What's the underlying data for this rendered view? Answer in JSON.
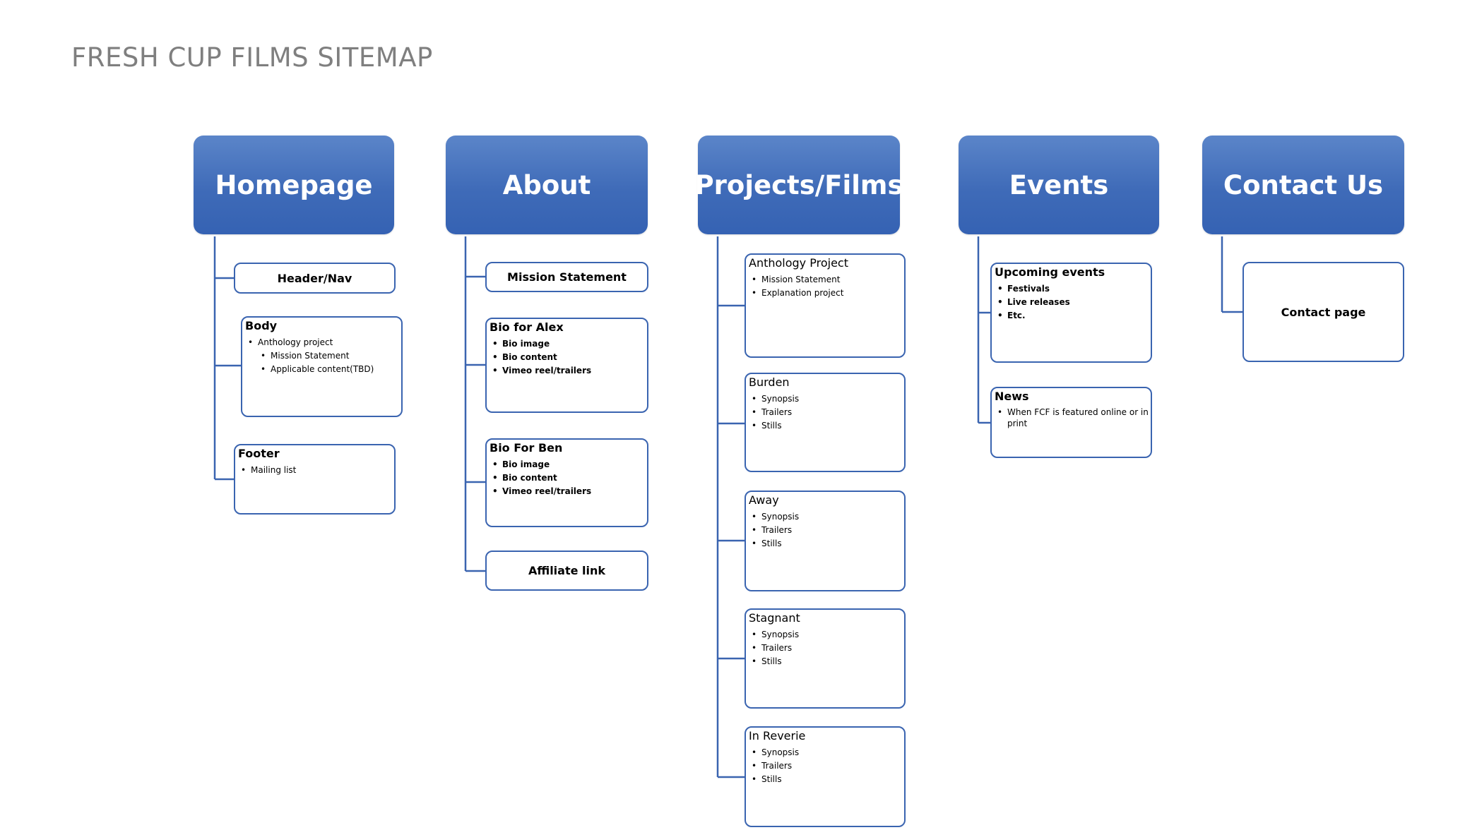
{
  "title": "FRESH CUP FILMS SITEMAP",
  "columns": [
    {
      "heading": "Homepage",
      "nodes": [
        {
          "label": "Header/Nav"
        },
        {
          "title": "Body",
          "items": [
            "Anthology project",
            "Mission Statement",
            "Applicable content(TBD)"
          ]
        },
        {
          "title": "Footer",
          "items": [
            "Mailing list"
          ]
        }
      ]
    },
    {
      "heading": "About",
      "nodes": [
        {
          "label": "Mission Statement"
        },
        {
          "title": "Bio for Alex",
          "items": [
            "Bio image",
            "Bio content",
            "Vimeo reel/trailers"
          ]
        },
        {
          "title": "Bio For Ben",
          "items": [
            "Bio image",
            "Bio content",
            "Vimeo reel/trailers"
          ]
        },
        {
          "label": "Affiliate  link"
        }
      ]
    },
    {
      "heading": "Projects/Films",
      "nodes": [
        {
          "title": "Anthology Project",
          "items": [
            "Mission Statement",
            "Explanation  project"
          ]
        },
        {
          "title": "Burden",
          "items": [
            "Synopsis",
            "Trailers",
            "Stills"
          ]
        },
        {
          "title": "Away",
          "items": [
            "Synopsis",
            "Trailers",
            "Stills"
          ]
        },
        {
          "title": "Stagnant",
          "items": [
            "Synopsis",
            "Trailers",
            "Stills"
          ]
        },
        {
          "title": "In Reverie",
          "items": [
            "Synopsis",
            "Trailers",
            "Stills"
          ]
        }
      ]
    },
    {
      "heading": "Events",
      "nodes": [
        {
          "title": "Upcoming events",
          "items": [
            "Festivals",
            "Live releases",
            "Etc."
          ]
        },
        {
          "title": "News",
          "items": [
            "When  FCF is featured  online or in print"
          ]
        }
      ]
    },
    {
      "heading": "Contact Us",
      "nodes": [
        {
          "label": "Contact page"
        }
      ]
    }
  ]
}
